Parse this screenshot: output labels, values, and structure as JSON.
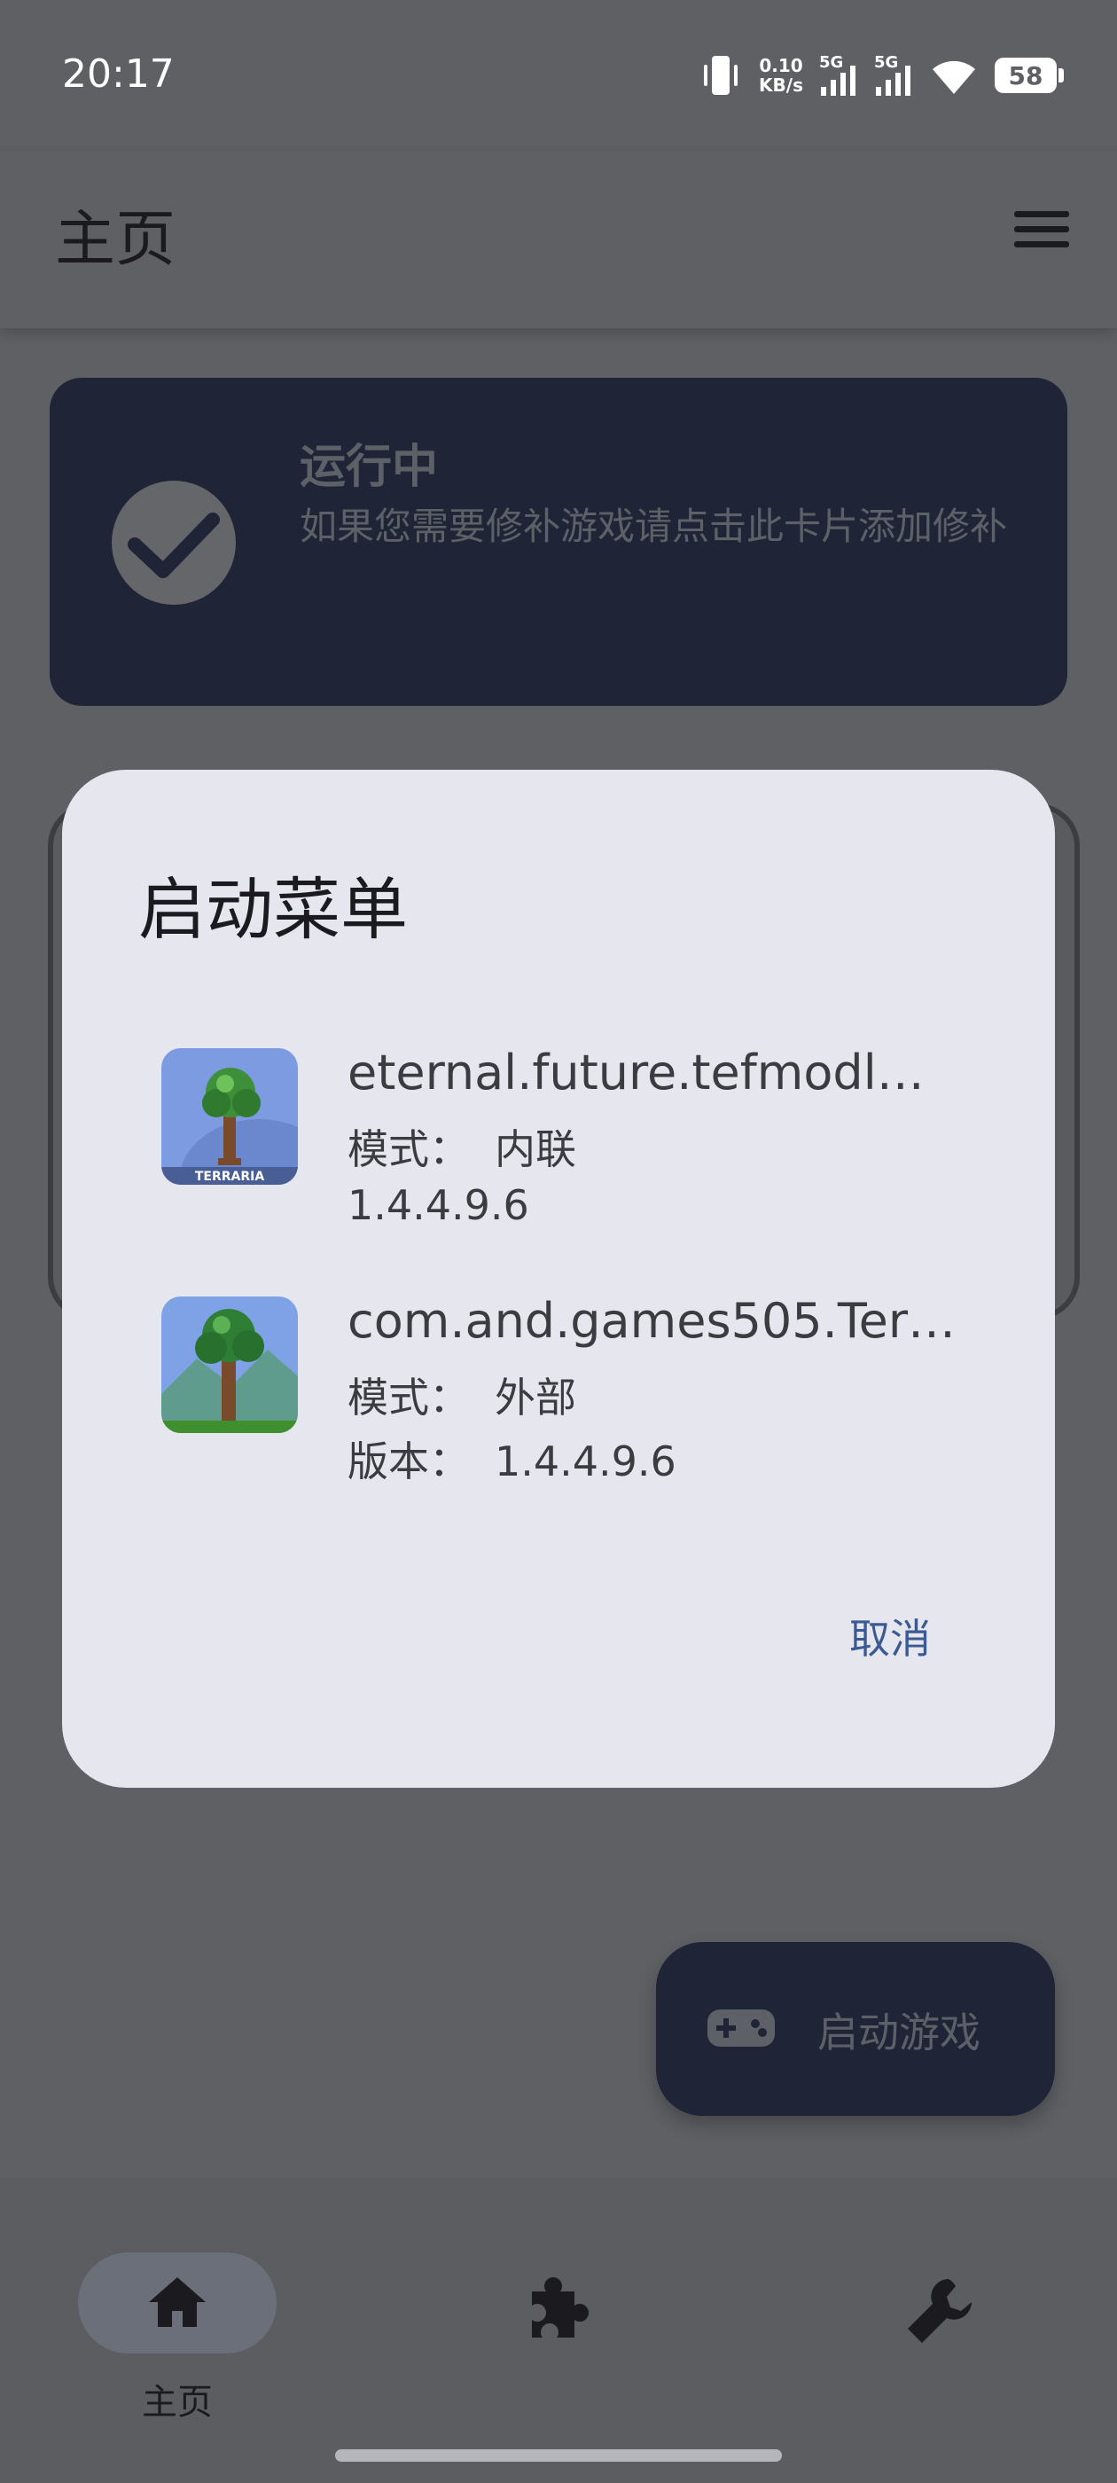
{
  "status_bar": {
    "time": "20:17",
    "net_speed_value": "0.10",
    "net_speed_unit": "KB/s",
    "signal1": "5G",
    "signal2": "5G",
    "battery": "58"
  },
  "header": {
    "title": "主页",
    "menu_icon": "hamburger-menu-icon"
  },
  "status_card": {
    "icon": "check-circle-icon",
    "title": "运行中",
    "description": "如果您需要修补游戏请点击此卡片添加修补"
  },
  "dialog": {
    "title": "启动菜单",
    "entries": [
      {
        "icon": "terraria-tree-icon",
        "package": "eternal.future.tefmodl…",
        "line2_label": "模式：",
        "line2_value": "内联",
        "line3_label": "",
        "line3_value": "1.4.4.9.6"
      },
      {
        "icon": "terraria-tree-icon",
        "package": "com.and.games505.Ter…",
        "line2_label": "模式：",
        "line2_value": "外部",
        "line3_label": "版本：",
        "line3_value": "1.4.4.9.6"
      }
    ],
    "cancel_label": "取消"
  },
  "fab": {
    "icon": "gamepad-icon",
    "label": "启动游戏"
  },
  "bottom_nav": {
    "items": [
      {
        "icon": "home-icon",
        "label": "主页",
        "active": true
      },
      {
        "icon": "puzzle-icon",
        "label": ""
      },
      {
        "icon": "wrench-icon",
        "label": ""
      }
    ]
  },
  "colors": {
    "card_bg": "#1f2536",
    "dialog_bg": "#e6e7ee",
    "accent_text": "#3b5a94",
    "scrim": "#5f6064"
  }
}
